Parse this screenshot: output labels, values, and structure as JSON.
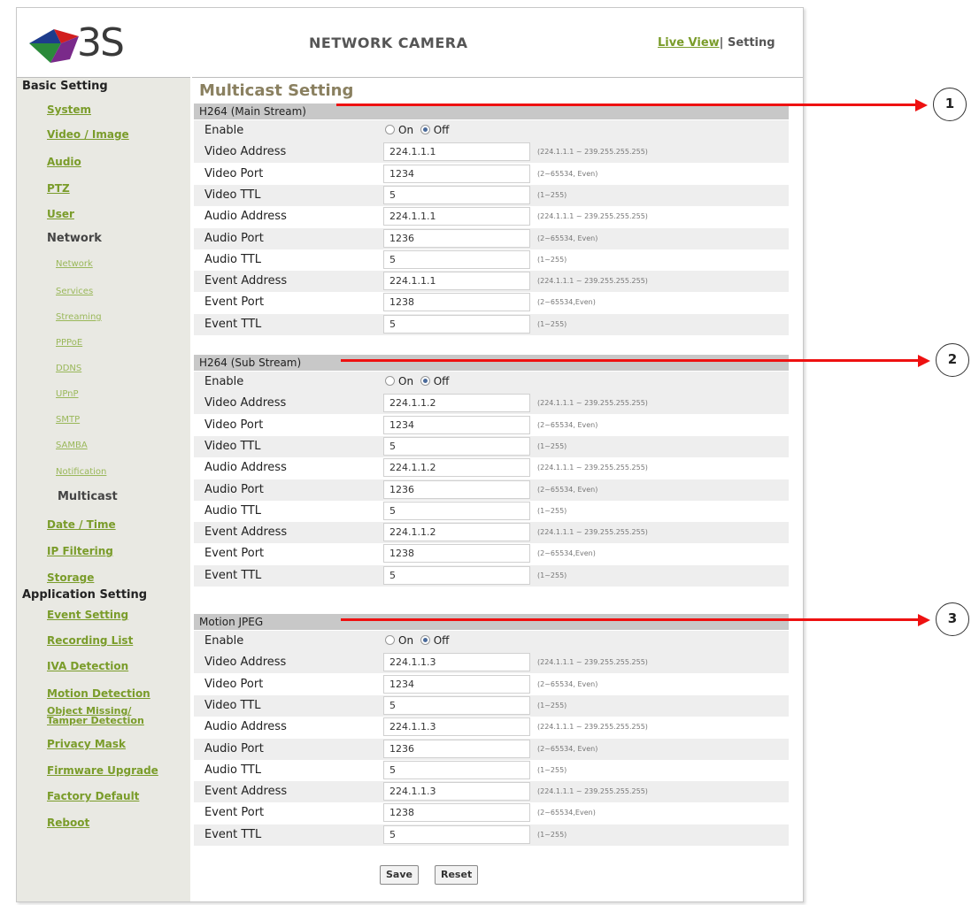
{
  "header": {
    "logo_text": "3S",
    "brand_title": "NETWORK CAMERA",
    "live_view": "Live View",
    "separator": "|",
    "setting": "Setting"
  },
  "sidebar": {
    "basic_heading": "Basic Setting",
    "system": "System",
    "video_image": "Video / Image",
    "audio": "Audio",
    "ptz": "PTZ",
    "user": "User",
    "network": "Network",
    "network_sub": [
      "Network",
      "Services",
      "Streaming",
      "PPPoE",
      "DDNS",
      "UPnP",
      "SMTP",
      "SAMBA",
      "Notification"
    ],
    "multicast": "Multicast",
    "date_time": "Date / Time",
    "ip_filtering": "IP Filtering",
    "storage": "Storage",
    "app_heading": "Application Setting",
    "event_setting": "Event Setting",
    "recording_list": "Recording List",
    "iva_detection": "IVA Detection",
    "motion_detection": "Motion Detection",
    "object_missing_1": "Object Missing/",
    "object_missing_2": "Tamper Detection",
    "privacy_mask": "Privacy Mask",
    "firmware_upgrade": "Firmware Upgrade",
    "factory_default": "Factory Default",
    "reboot": "Reboot"
  },
  "main": {
    "title": "Multicast Setting",
    "radio_on": "On",
    "radio_off": "Off",
    "labels": {
      "enable": "Enable",
      "video_address": "Video Address",
      "video_port": "Video Port",
      "video_ttl": "Video TTL",
      "audio_address": "Audio Address",
      "audio_port": "Audio Port",
      "audio_ttl": "Audio TTL",
      "event_address": "Event Address",
      "event_port": "Event Port",
      "event_ttl": "Event TTL"
    },
    "hints": {
      "address": "(224.1.1.1 ~ 239.255.255.255)",
      "port": "(2~65534, Even)",
      "port_event": "(2~65534,Even)",
      "ttl": "(1~255)"
    },
    "sections": [
      {
        "title": "H264 (Main Stream)",
        "enabled": false,
        "video_address": "224.1.1.1",
        "video_port": "1234",
        "video_ttl": "5",
        "audio_address": "224.1.1.1",
        "audio_port": "1236",
        "audio_ttl": "5",
        "event_address": "224.1.1.1",
        "event_port": "1238",
        "event_ttl": "5"
      },
      {
        "title": "H264 (Sub Stream)",
        "enabled": false,
        "video_address": "224.1.1.2",
        "video_port": "1234",
        "video_ttl": "5",
        "audio_address": "224.1.1.2",
        "audio_port": "1236",
        "audio_ttl": "5",
        "event_address": "224.1.1.2",
        "event_port": "1238",
        "event_ttl": "5"
      },
      {
        "title": "Motion JPEG",
        "enabled": false,
        "video_address": "224.1.1.3",
        "video_port": "1234",
        "video_ttl": "5",
        "audio_address": "224.1.1.3",
        "audio_port": "1236",
        "audio_ttl": "5",
        "event_address": "224.1.1.3",
        "event_port": "1238",
        "event_ttl": "5"
      }
    ],
    "save": "Save",
    "reset": "Reset"
  },
  "callouts": [
    "1",
    "2",
    "3"
  ],
  "colors": {
    "link_green": "#7a9c2a",
    "callout_red": "#ee1111",
    "section_gray": "#c8c8c8"
  }
}
